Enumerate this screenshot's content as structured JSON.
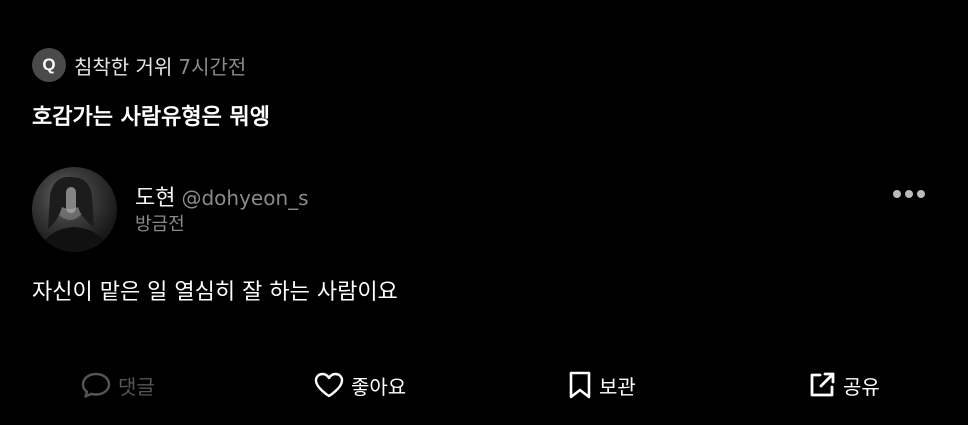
{
  "question": {
    "badge": "Q",
    "asker": "침착한 거위",
    "time": "7시간전",
    "text": "호감가는 사람유형은 뭐엥"
  },
  "answer": {
    "author_name": "도현",
    "author_handle": "@dohyeon_s",
    "time": "방금전",
    "text": "자신이 맡은 일 열심히 잘 하는 사람이요"
  },
  "actions": {
    "comment": "댓글",
    "like": "좋아요",
    "save": "보관",
    "share": "공유"
  },
  "icons": {
    "more": "more-horizontal-icon",
    "comment": "comment-bubble-icon",
    "like": "heart-icon",
    "save": "bookmark-icon",
    "share": "share-icon"
  },
  "colors": {
    "background": "#000000",
    "text": "#ffffff",
    "muted": "#8a8a8a",
    "disabled": "#555555",
    "badge": "#4a4a4a"
  }
}
